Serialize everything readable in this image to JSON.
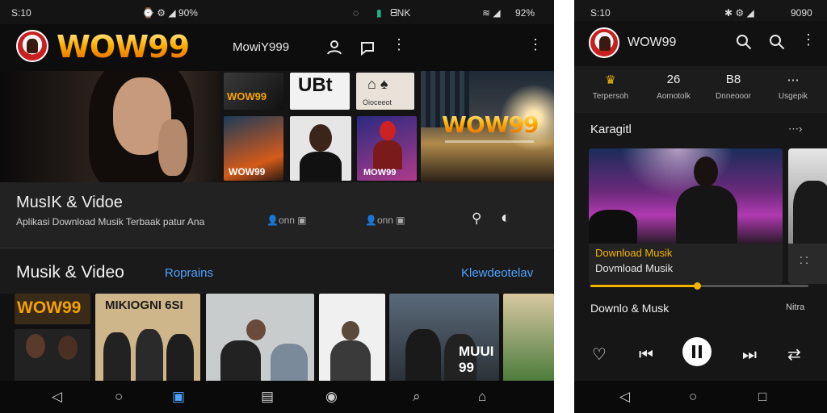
{
  "left": {
    "status": {
      "time": "S:10",
      "center_icons": "⌚ ⚙ ◢ 90%",
      "right_text": "ᗺNK",
      "battery": "92%"
    },
    "appbar": {
      "logo_text": "WOW99",
      "title": "MowiY999"
    },
    "hero": {
      "tiles": [
        {
          "caption": "WOW99"
        },
        {
          "caption": "UBt"
        },
        {
          "caption": "Oioceeot"
        },
        {
          "caption": "WOW99"
        },
        {
          "caption": ""
        },
        {
          "caption": "MOW99"
        }
      ],
      "banner_logo": "WOW99"
    },
    "info": {
      "title": "MusIK & Vidoe",
      "subtitle": "Aplikasi Download Musik Terbaak patur Ana",
      "chip1": "👤onn",
      "chip2": "👤onn"
    },
    "section": {
      "title": "Musik & Video",
      "link1": "Roprains",
      "link2": "Klewdeotelav"
    },
    "gallery": {
      "tile1_caption": "WOW99",
      "tile2_caption": "MIKIOGNI 6SI",
      "tile6_caption": "MUUI 99"
    },
    "nav": [
      "◁",
      "○",
      "▣",
      "▤",
      "◉",
      "⌕",
      "⌂"
    ]
  },
  "right": {
    "status": {
      "time": "S:10",
      "icons": "✱ ⚙ ◢",
      "battery": "9090"
    },
    "appbar": {
      "title": "WOW99"
    },
    "tabs": [
      {
        "top": "♛",
        "label": "Terpersoh"
      },
      {
        "top": "26",
        "label": "Aomotolk"
      },
      {
        "top": "B8",
        "label": "Dnneooor"
      },
      {
        "top": "⋯",
        "label": "Usgepik"
      }
    ],
    "section": {
      "title": "Karagitl",
      "more": "⋯›"
    },
    "card": {
      "title": "Download Musik",
      "subtitle": "Dovmload Musik"
    },
    "progress": 0.49,
    "now": {
      "title": "Downlo & Musk",
      "side": "Nitra"
    },
    "nav": [
      "◁",
      "○",
      "□"
    ]
  },
  "colors": {
    "accent": "#f5b400",
    "link": "#4da3ff",
    "brand": "#e25a00"
  }
}
